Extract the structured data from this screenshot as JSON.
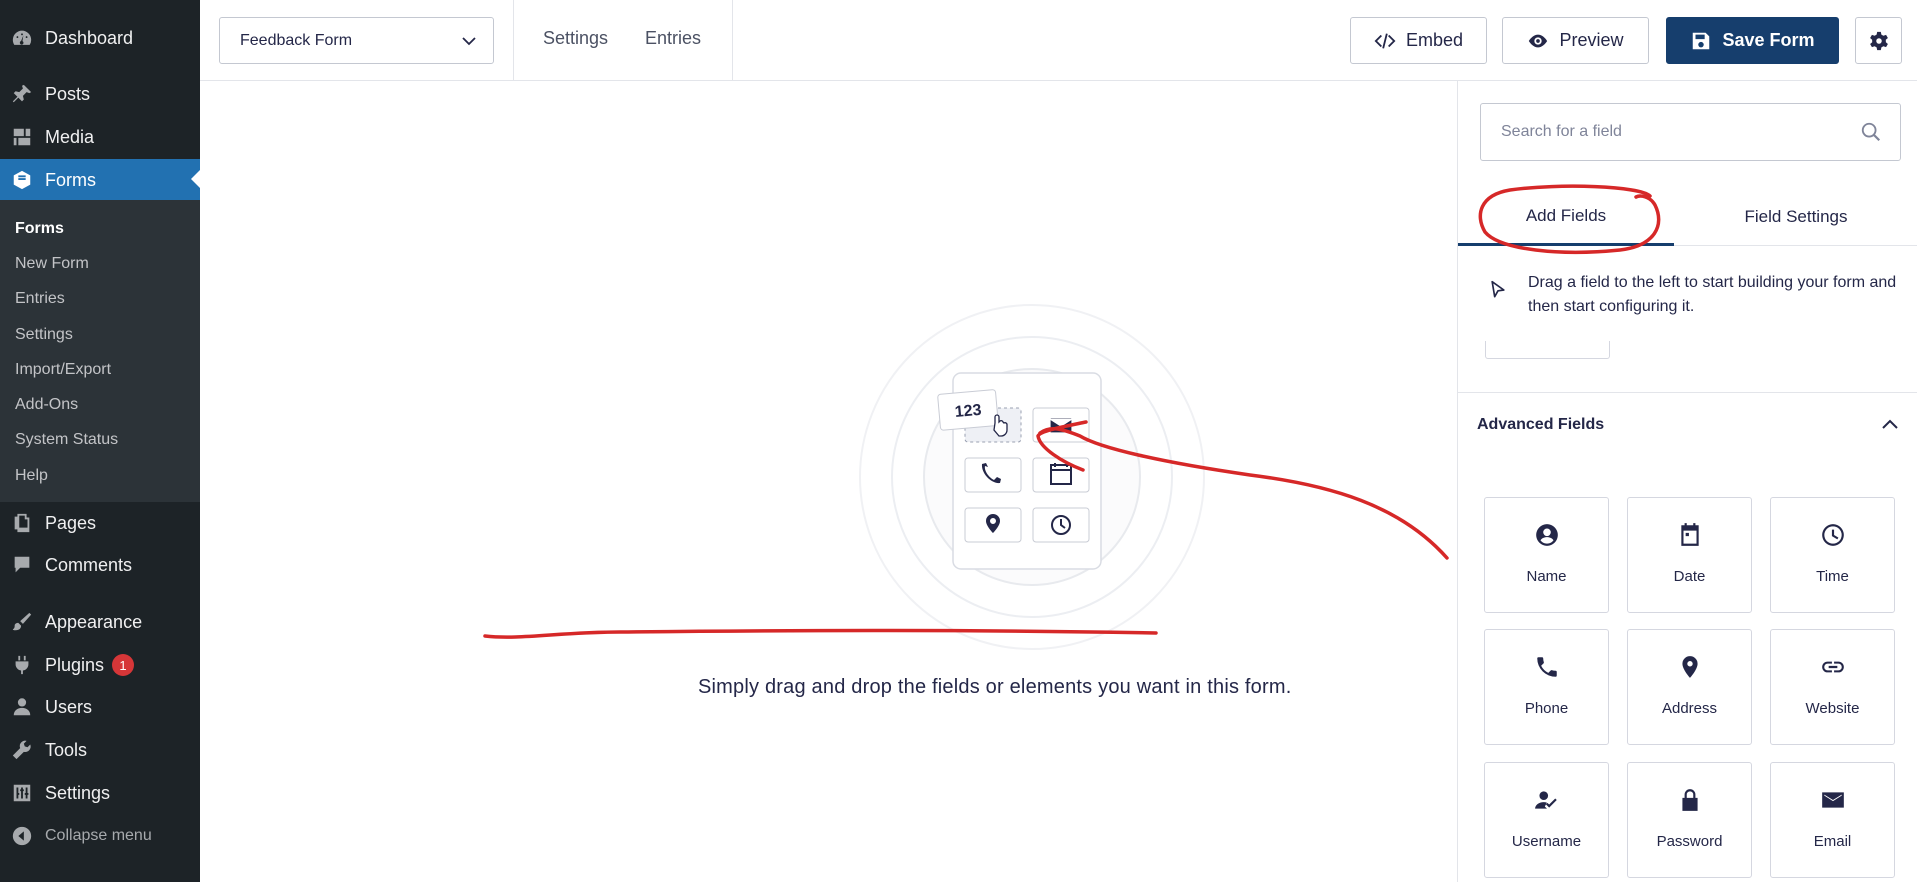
{
  "sidebar": {
    "items": [
      {
        "key": "dashboard",
        "label": "Dashboard",
        "icon": "dashboard-icon"
      },
      {
        "key": "posts",
        "label": "Posts",
        "icon": "pin-icon"
      },
      {
        "key": "media",
        "label": "Media",
        "icon": "media-icon"
      },
      {
        "key": "forms",
        "label": "Forms",
        "icon": "forms-icon",
        "current": true
      },
      {
        "key": "pages",
        "label": "Pages",
        "icon": "page-icon"
      },
      {
        "key": "comments",
        "label": "Comments",
        "icon": "comment-icon"
      },
      {
        "key": "appearance",
        "label": "Appearance",
        "icon": "brush-icon"
      },
      {
        "key": "plugins",
        "label": "Plugins",
        "icon": "plug-icon",
        "badge": "1"
      },
      {
        "key": "users",
        "label": "Users",
        "icon": "user-icon"
      },
      {
        "key": "tools",
        "label": "Tools",
        "icon": "wrench-icon"
      },
      {
        "key": "settings",
        "label": "Settings",
        "icon": "sliders-icon"
      }
    ],
    "submenu": [
      "Forms",
      "New Form",
      "Entries",
      "Settings",
      "Import/Export",
      "Add-Ons",
      "System Status",
      "Help"
    ],
    "collapse_label": "Collapse menu"
  },
  "toolbar": {
    "form_name": "Feedback Form",
    "links": [
      "Settings",
      "Entries"
    ],
    "embed_label": "Embed",
    "preview_label": "Preview",
    "save_label": "Save Form"
  },
  "canvas": {
    "message": "Simply drag and drop the fields or elements you want in this form.",
    "illustration_badge": "123"
  },
  "panel": {
    "search_placeholder": "Search for a field",
    "tabs": [
      "Add Fields",
      "Field Settings"
    ],
    "drag_hint": "Drag a field to the left to start building your form and then start configuring it.",
    "section_title": "Advanced Fields",
    "fields": [
      {
        "label": "Name",
        "icon": "person-circle-icon"
      },
      {
        "label": "Date",
        "icon": "calendar-icon"
      },
      {
        "label": "Time",
        "icon": "clock-icon"
      },
      {
        "label": "Phone",
        "icon": "phone-icon"
      },
      {
        "label": "Address",
        "icon": "location-pin-icon"
      },
      {
        "label": "Website",
        "icon": "link-icon"
      },
      {
        "label": "Username",
        "icon": "user-check-icon"
      },
      {
        "label": "Password",
        "icon": "lock-icon"
      },
      {
        "label": "Email",
        "icon": "envelope-icon"
      }
    ]
  },
  "colors": {
    "wp_sidebar": "#1d2327",
    "wp_submenu": "#2c3338",
    "wp_active": "#2271b1",
    "save_button": "#163e6d",
    "annotation_red": "#d62828"
  }
}
